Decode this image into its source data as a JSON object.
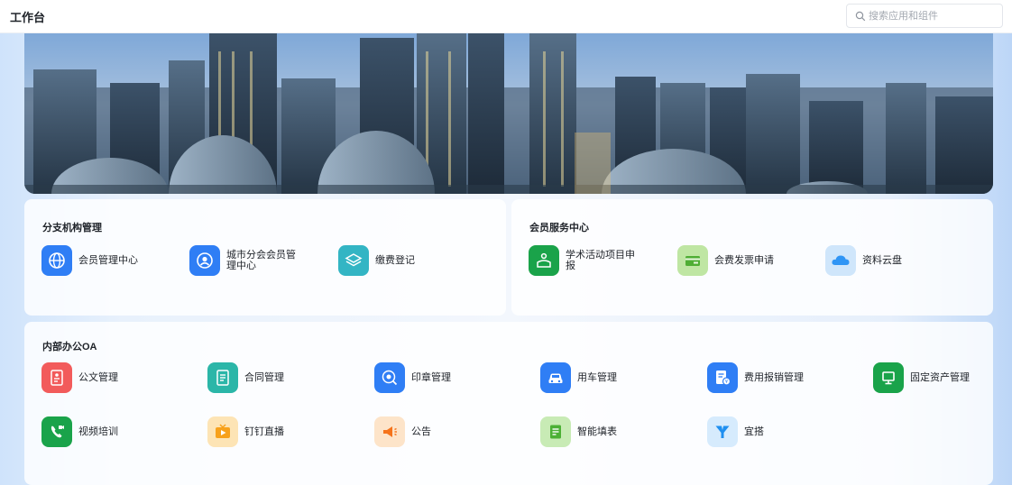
{
  "header": {
    "title": "工作台",
    "search_placeholder": "搜索应用和组件"
  },
  "sections": {
    "branch": {
      "title": "分支机构管理",
      "apps": [
        {
          "label": "会员管理中心",
          "icon": "globe-icon",
          "color": "#2f7ef5"
        },
        {
          "label": "城市分会会员管理中心",
          "icon": "member-center-icon",
          "color": "#2f7ef5"
        },
        {
          "label": "缴费登记",
          "icon": "layers-icon",
          "color": "#33b5c4"
        }
      ]
    },
    "member_service": {
      "title": "会员服务中心",
      "apps": [
        {
          "label": "学术活动项目申报",
          "icon": "activity-icon",
          "color": "#1aa34a"
        },
        {
          "label": "会费发票申请",
          "icon": "invoice-icon",
          "color": "#8ad46a"
        },
        {
          "label": "资料云盘",
          "icon": "cloud-icon",
          "color": "#2f95f5"
        }
      ]
    },
    "oa": {
      "title": "内部办公OA",
      "apps": [
        {
          "label": "公文管理",
          "icon": "document-icon",
          "color": "#f25b5b"
        },
        {
          "label": "合同管理",
          "icon": "contract-icon",
          "color": "#2bb6a8"
        },
        {
          "label": "印章管理",
          "icon": "seal-icon",
          "color": "#2f7ef5"
        },
        {
          "label": "用车管理",
          "icon": "car-icon",
          "color": "#2f7ef5"
        },
        {
          "label": "费用报销管理",
          "icon": "expense-icon",
          "color": "#2f7ef5"
        },
        {
          "label": "固定资产管理",
          "icon": "asset-icon",
          "color": "#1aa34a"
        },
        {
          "label": "视频培训",
          "icon": "video-call-icon",
          "color": "#1aa34a"
        },
        {
          "label": "钉钉直播",
          "icon": "live-icon",
          "color": "#f7b11b"
        },
        {
          "label": "公告",
          "icon": "megaphone-icon",
          "color": "#f7a11b"
        },
        {
          "label": "智能填表",
          "icon": "form-icon",
          "color": "#6cc24a"
        },
        {
          "label": "宜搭",
          "icon": "yida-icon",
          "color": "#2f95f5"
        }
      ]
    }
  }
}
